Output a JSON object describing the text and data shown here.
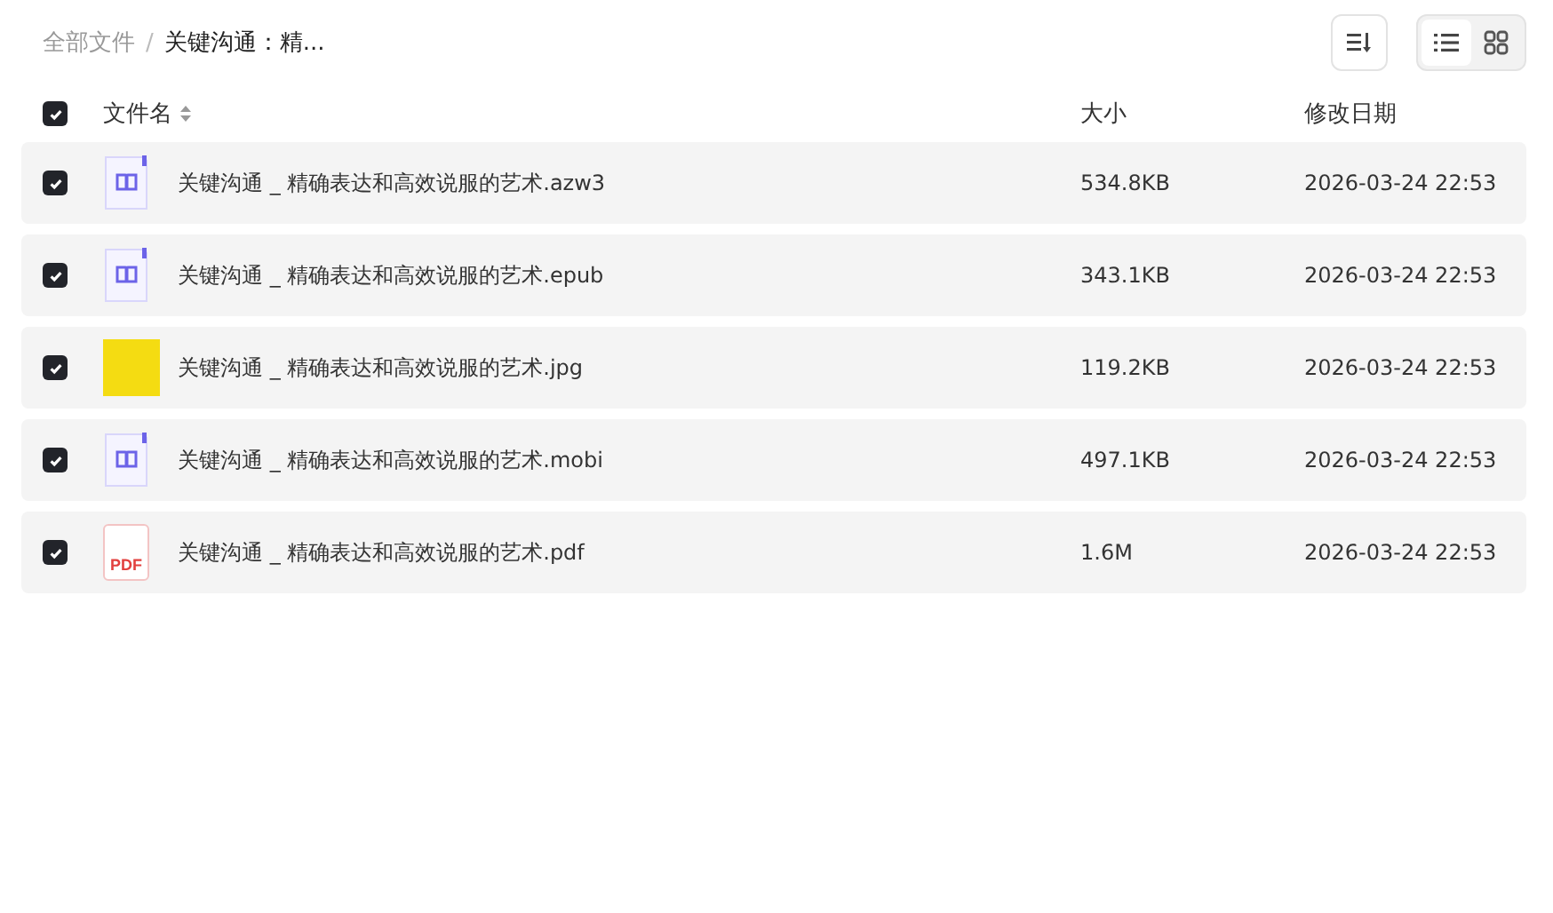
{
  "breadcrumb_separator": "/",
  "breadcrumb": [
    {
      "label": "全部文件",
      "current": false
    },
    {
      "label": "关键沟通：精...",
      "current": true
    }
  ],
  "view_toggle": [
    {
      "kind": "list",
      "selected": true
    },
    {
      "kind": "grid",
      "selected": false
    }
  ],
  "table": {
    "select_all": {
      "checked": true
    },
    "columns": [
      "文件名",
      "大小",
      "修改日期"
    ],
    "rows": [
      {
        "kind": "ebook",
        "name": "关键沟通 _ 精确表达和高效说服的艺术.azw3",
        "size": "534.8KB",
        "date": "2026-03-24 22:53",
        "checked": true
      },
      {
        "kind": "ebook",
        "name": "关键沟通 _ 精确表达和高效说服的艺术.epub",
        "size": "343.1KB",
        "date": "2026-03-24 22:53",
        "checked": true
      },
      {
        "kind": "image",
        "name": "关键沟通 _ 精确表达和高效说服的艺术.jpg",
        "size": "119.2KB",
        "date": "2026-03-24 22:53",
        "checked": true
      },
      {
        "kind": "ebook",
        "name": "关键沟通 _ 精确表达和高效说服的艺术.mobi",
        "size": "497.1KB",
        "date": "2026-03-24 22:53",
        "checked": true
      },
      {
        "kind": "pdf",
        "icon_text": "PDF",
        "name": "关键沟通 _ 精确表达和高效说服的艺术.pdf",
        "size": "1.6M",
        "date": "2026-03-24 22:53",
        "checked": true
      }
    ]
  }
}
